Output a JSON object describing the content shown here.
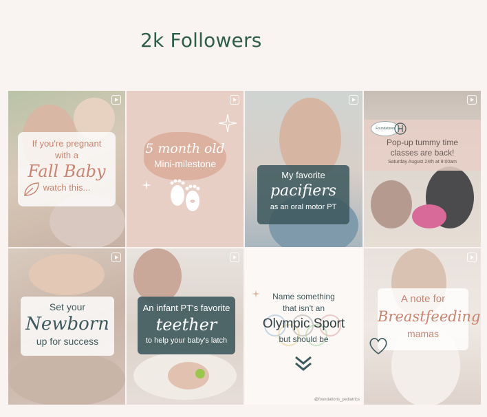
{
  "header": {
    "title": "2k Followers"
  },
  "posts": [
    {
      "line1": "If you're pregnant",
      "line2": "with a",
      "script": "Fall Baby",
      "line3": "watch this..."
    },
    {
      "script": "5 month old",
      "line2": "Mini-milestone"
    },
    {
      "line1": "My favorite",
      "script": "pacifiers",
      "line3": "as an oral motor PT"
    },
    {
      "line1": "Pop-up tummy time",
      "line2": "classes are back!",
      "line3": "Saturday August 24th at 9:00am",
      "logo_text": "Foundations"
    },
    {
      "line1": "Set your",
      "script": "Newborn",
      "line3": "up for success"
    },
    {
      "line1": "An infant PT's favorite",
      "script": "teether",
      "line3": "to help your baby's latch"
    },
    {
      "line1": "Name something",
      "line2": "that isn't an",
      "big": "Olympic Sport",
      "line3": "but should be",
      "handle": "@foundations_pediatrics"
    },
    {
      "line1": "A note for",
      "script": "Breastfeeding",
      "line3": "mamas"
    }
  ],
  "colors": {
    "title": "#2e5e4a",
    "pink": "#e8cfc6",
    "teal": "#3f5a5e",
    "accent": "#c9836f"
  }
}
